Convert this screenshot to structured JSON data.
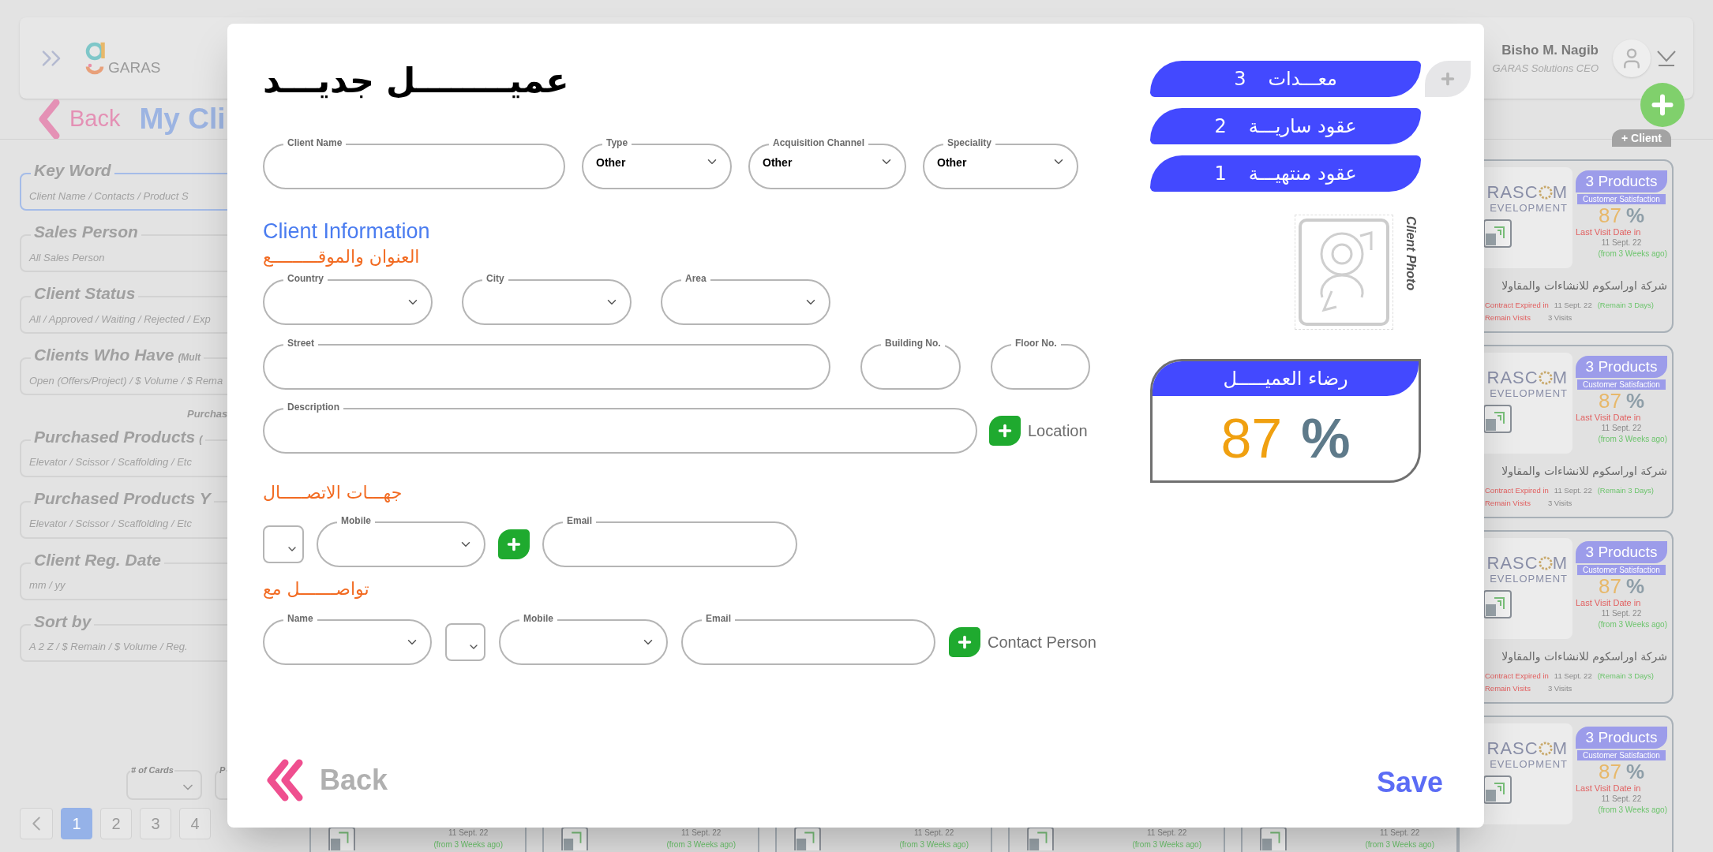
{
  "header": {
    "app_name": "GARAS",
    "user_name": "Bisho M. Nagib",
    "user_role": "GARAS Solutions CEO"
  },
  "page": {
    "back_label": "Back",
    "title": "My Cli",
    "add_label": "+ Client"
  },
  "filters": [
    {
      "label": "Key Word",
      "placeholder": "Client Name / Contacts / Product S",
      "focused": true
    },
    {
      "label": "Sales Person",
      "placeholder": "All Sales Person",
      "focused": false
    },
    {
      "label": "Client Status",
      "placeholder": "All / Approved / Waiting / Rejected / Exp",
      "focused": false
    },
    {
      "label": "Clients Who Have",
      "note": "(Mult",
      "placeholder": "Open (Offers/Project) / $ Volume / $ Rema",
      "focused": false
    },
    {
      "label": "Purchased Products",
      "note": "(",
      "placeholder": "Elevator / Scissor / Scaffolding / Etc",
      "focused": false,
      "hint": "Purchas"
    },
    {
      "label": "Purchased Products Y",
      "placeholder": "Elevator / Scissor / Scaffolding / Etc",
      "focused": false
    },
    {
      "label": "Client Reg. Date",
      "placeholder": "mm / yy",
      "focused": false
    },
    {
      "label": "Sort by",
      "placeholder": "A 2 Z / $ Remain / $ Volume / Reg.",
      "focused": false
    }
  ],
  "pagination": {
    "cards_label": "# of Cards",
    "second_label": "P",
    "pages": [
      {
        "label": "1",
        "selected": true
      },
      {
        "label": "2",
        "selected": false
      },
      {
        "label": "3",
        "selected": false
      },
      {
        "label": "4",
        "selected": false
      }
    ]
  },
  "bottom_cards": [
    {
      "date": "11 Sept. 22",
      "ago": "(from 3 Weeks ago)"
    },
    {
      "date": "11 Sept. 22",
      "ago": "(from 3 Weeks ago)"
    },
    {
      "date": "11 Sept. 22",
      "ago": "(from 3 Weeks ago)"
    },
    {
      "date": "11 Sept. 22",
      "ago": "(from 3 Weeks ago)"
    },
    {
      "date": "11 Sept. 22",
      "ago": "(from 3 Weeks ago)"
    }
  ],
  "client_cards": [
    {
      "logo_top": [
        "RASC",
        "M"
      ],
      "logo_bottom": "EVELOPMENT",
      "products": "3 Products",
      "satisfaction_label": "Customer Satisfaction",
      "score": "87",
      "percent": "%",
      "last_visit_label": "Last Visit Date in",
      "last_visit_date": "11 Sept. 22",
      "last_visit_ago": "(from 3 Weeks ago)",
      "company": "شركة اوراسكوم للانشاءات والمقاولا",
      "contract_label": "Contract Expired in",
      "contract_date": "11 Sept. 22",
      "contract_remain": "(Remain 3 Days)",
      "visits_label": "Remain Visits",
      "visits": "3 Visits"
    },
    {
      "logo_top": [
        "RASC",
        "M"
      ],
      "logo_bottom": "EVELOPMENT",
      "products": "3 Products",
      "satisfaction_label": "Customer Satisfaction",
      "score": "87",
      "percent": "%",
      "last_visit_label": "Last Visit Date in",
      "last_visit_date": "11 Sept. 22",
      "last_visit_ago": "(from 3 Weeks ago)",
      "company": "شركة اوراسكوم للانشاءات والمقاولا",
      "contract_label": "Contract Expired in",
      "contract_date": "11 Sept. 22",
      "contract_remain": "(Remain 3 Days)",
      "visits_label": "Remain Visits",
      "visits": "3 Visits"
    },
    {
      "logo_top": [
        "RASC",
        "M"
      ],
      "logo_bottom": "EVELOPMENT",
      "products": "3 Products",
      "satisfaction_label": "Customer Satisfaction",
      "score": "87",
      "percent": "%",
      "last_visit_label": "Last Visit Date in",
      "last_visit_date": "11 Sept. 22",
      "last_visit_ago": "(from 3 Weeks ago)",
      "company": "شركة اوراسكوم للانشاءات والمقاولا",
      "contract_label": "Contract Expired in",
      "contract_date": "11 Sept. 22",
      "contract_remain": "(Remain 3 Days)",
      "visits_label": "Remain Visits",
      "visits": "3 Visits"
    },
    {
      "logo_top": [
        "RASC",
        "M"
      ],
      "logo_bottom": "EVELOPMENT",
      "products": "3 Products",
      "satisfaction_label": "Customer Satisfaction",
      "score": "87",
      "percent": "%",
      "last_visit_label": "Last Visit Date in",
      "last_visit_date": "11 Sept. 22",
      "last_visit_ago": "(from 3 Weeks ago)"
    }
  ],
  "modal": {
    "title": "عميــــــــل جديـــد",
    "top_fields": [
      {
        "label": "Client Name",
        "kind": "text"
      },
      {
        "label": "Type",
        "kind": "select",
        "value": "Other"
      },
      {
        "label": "Acquisition Channel",
        "kind": "select",
        "value": "Other"
      },
      {
        "label": "Speciality",
        "kind": "select",
        "value": "Other"
      }
    ],
    "section_title": "Client Information",
    "address_heading": "العنوان والموقـــــــــع",
    "address_row1": [
      {
        "label": "Country",
        "kind": "select"
      },
      {
        "label": "City",
        "kind": "select"
      },
      {
        "label": "Area",
        "kind": "select"
      }
    ],
    "address_row2": [
      {
        "label": "Street",
        "kind": "text"
      },
      {
        "label": "Building No.",
        "kind": "text"
      },
      {
        "label": "Floor No.",
        "kind": "text"
      }
    ],
    "description_row": [
      {
        "label": "Description",
        "kind": "text"
      },
      {
        "kind": "add",
        "caption": "Location"
      }
    ],
    "contacts_heading": "جهـــات الاتصـــــال",
    "contacts_row": [
      {
        "kind": "code"
      },
      {
        "label": "Mobile",
        "kind": "select"
      },
      {
        "kind": "add"
      },
      {
        "label": "Email",
        "kind": "text"
      }
    ],
    "reach_heading": "تواصـــــــل مع",
    "reach_row": [
      {
        "label": "Name",
        "kind": "select"
      },
      {
        "kind": "code"
      },
      {
        "label": "Mobile",
        "kind": "select"
      },
      {
        "label": "Email",
        "kind": "text"
      },
      {
        "kind": "add",
        "caption": "Contact Person"
      }
    ],
    "stats": [
      {
        "label": "معـــدات",
        "count": "3"
      },
      {
        "label": "عقود ساريـــة",
        "count": "2"
      },
      {
        "label": "عقود منتهيـــة",
        "count": "1"
      }
    ],
    "photo_label": "Client Photo",
    "satisfaction": {
      "title": "رضاء العميـــــل",
      "score": "87",
      "percent": "%"
    },
    "back_label": "Back",
    "save_label": "Save"
  }
}
